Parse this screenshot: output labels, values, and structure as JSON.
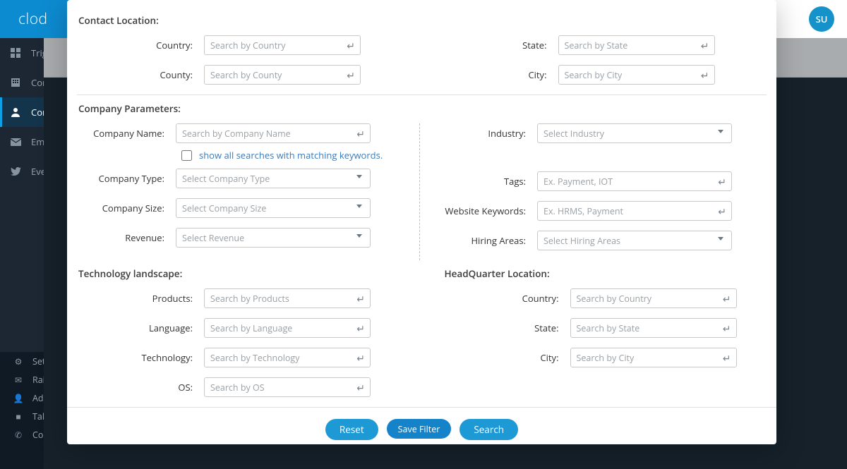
{
  "brand": "clod",
  "avatar_initials": "SU",
  "sidebar": {
    "top": [
      {
        "label": "Trig"
      },
      {
        "label": "Con"
      },
      {
        "label": "Con"
      },
      {
        "label": "Em"
      },
      {
        "label": "Eve"
      }
    ],
    "bottom": [
      {
        "label": "Sett"
      },
      {
        "label": "Raise"
      },
      {
        "label": "Adm"
      },
      {
        "label": "Take"
      },
      {
        "label": "Cont"
      }
    ]
  },
  "sections": {
    "contact_location": "Contact Location:",
    "company_params": "Company Parameters:",
    "tech": "Technology landscape:",
    "hq": "HeadQuarter Location:"
  },
  "labels": {
    "country": "Country:",
    "county": "County:",
    "state": "State:",
    "city": "City:",
    "company_name": "Company Name:",
    "company_type": "Company Type:",
    "company_size": "Company Size:",
    "revenue": "Revenue:",
    "industry": "Industry:",
    "tags": "Tags:",
    "website": "Website Keywords:",
    "hiring": "Hiring Areas:",
    "products": "Products:",
    "language": "Language:",
    "technology": "Technology:",
    "os": "OS:",
    "show_all": "show all searches with matching keywords."
  },
  "placeholders": {
    "country": "Search by Country",
    "county": "Search by County",
    "state": "Search by State",
    "city": "Search by City",
    "company_name": "Search by Company Name",
    "company_type": "Select Company Type",
    "company_size": "Select Company Size",
    "revenue": "Select Revenue",
    "industry": "Select Industry",
    "tags": "Ex. Payment, IOT",
    "website": "Ex. HRMS, Payment",
    "hiring": "Select Hiring Areas",
    "products": "Search by Products",
    "language": "Search by Language",
    "technology": "Search by Technology",
    "os": "Search by OS"
  },
  "buttons": {
    "reset": "Reset",
    "save": "Save Filter",
    "search": "Search"
  }
}
